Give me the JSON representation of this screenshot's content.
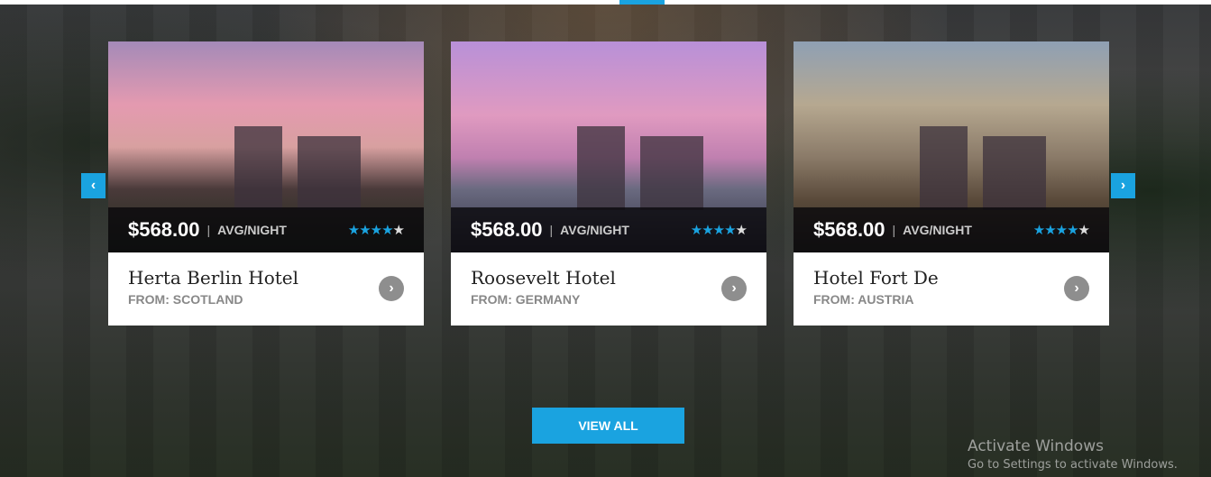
{
  "carousel": {
    "prev_icon": "chevron-left-icon",
    "next_icon": "chevron-right-icon",
    "prev_glyph": "‹",
    "next_glyph": "›"
  },
  "cards": [
    {
      "price": "$568.00",
      "separator": "|",
      "per": "AVG/NIGHT",
      "rating": 4,
      "max_rating": 5,
      "name": "Herta Berlin Hotel",
      "from": "FROM: SCOTLAND",
      "go": "›"
    },
    {
      "price": "$568.00",
      "separator": "|",
      "per": "AVG/NIGHT",
      "rating": 4,
      "max_rating": 5,
      "name": "Roosevelt Hotel",
      "from": "FROM: GERMANY",
      "go": "›"
    },
    {
      "price": "$568.00",
      "separator": "|",
      "per": "AVG/NIGHT",
      "rating": 4,
      "max_rating": 5,
      "name": "Hotel Fort De",
      "from": "FROM: AUSTRIA",
      "go": "›"
    }
  ],
  "view_all": "VIEW ALL",
  "watermark": {
    "title": "Activate Windows",
    "subtitle": "Go to Settings to activate Windows."
  },
  "colors": {
    "accent": "#1aa3e0",
    "star_off": "#dddddd"
  }
}
